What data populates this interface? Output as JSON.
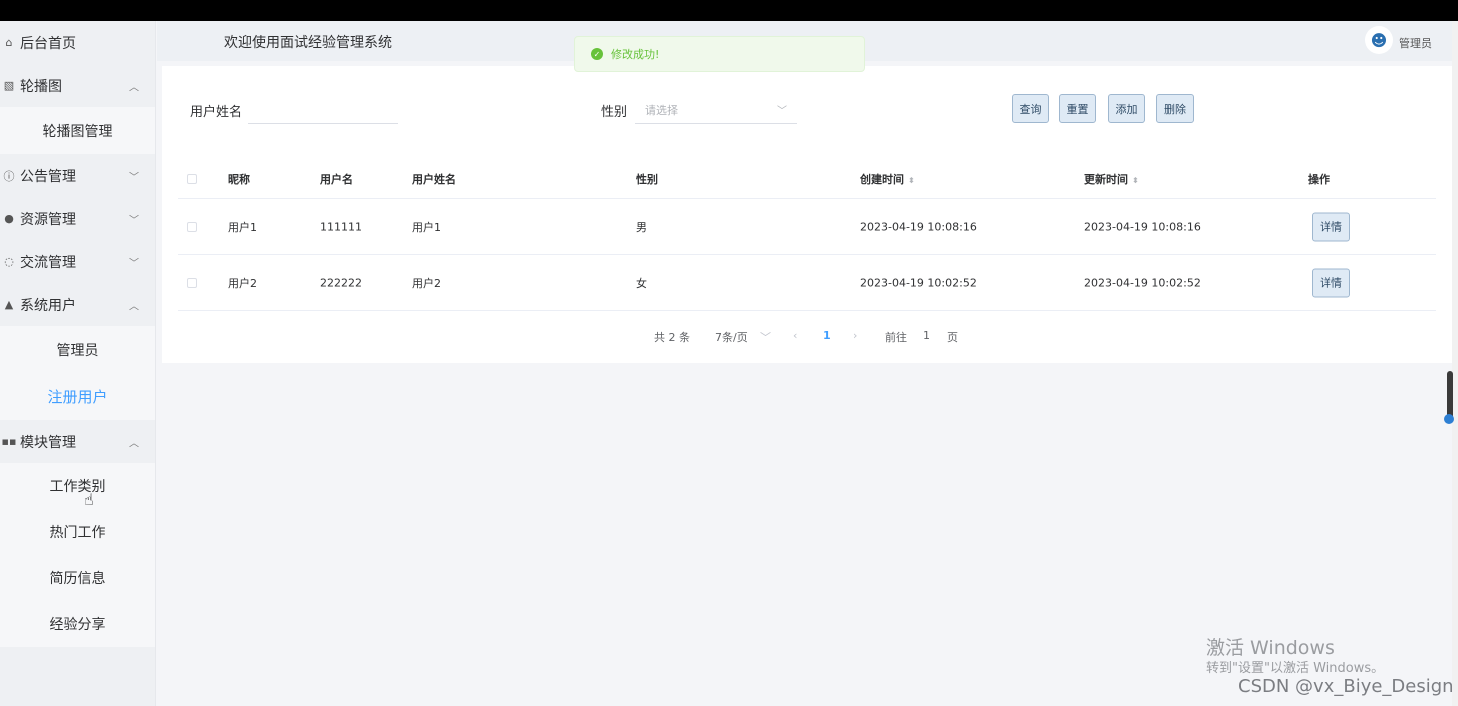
{
  "header": {
    "title": "欢迎使用面试经验管理系统",
    "user": "管理员"
  },
  "toast": {
    "message": "修改成功!"
  },
  "sidebar": {
    "home": "后台首页",
    "carousel": "轮播图",
    "carousel_manage": "轮播图管理",
    "notice": "公告管理",
    "resource": "资源管理",
    "exchange": "交流管理",
    "system_users": "系统用户",
    "admin": "管理员",
    "registered": "注册用户",
    "modules": "模块管理",
    "job_category": "工作类别",
    "hot_jobs": "热门工作",
    "resume": "简历信息",
    "experience": "经验分享"
  },
  "search": {
    "username_label": "用户姓名",
    "username_value": "",
    "gender_label": "性别",
    "gender_placeholder": "请选择",
    "query_btn": "查询",
    "reset_btn": "重置",
    "add_btn": "添加",
    "delete_btn": "删除"
  },
  "table": {
    "headers": {
      "nickname": "昵称",
      "username": "用户名",
      "realname": "用户姓名",
      "gender": "性别",
      "created": "创建时间",
      "updated": "更新时间",
      "actions": "操作"
    },
    "rows": [
      {
        "nickname": "用户1",
        "username": "111111",
        "realname": "用户1",
        "gender": "男",
        "created": "2023-04-19 10:08:16",
        "updated": "2023-04-19 10:08:16",
        "action": "详情"
      },
      {
        "nickname": "用户2",
        "username": "222222",
        "realname": "用户2",
        "gender": "女",
        "created": "2023-04-19 10:02:52",
        "updated": "2023-04-19 10:02:52",
        "action": "详情"
      }
    ]
  },
  "pager": {
    "total": "共 2 条",
    "size": "7条/页",
    "current": "1",
    "goto_prefix": "前往",
    "goto_value": "1",
    "goto_suffix": "页"
  },
  "watermark": {
    "activate_title": "激活 Windows",
    "activate_sub": "转到\"设置\"以激活 Windows。",
    "csdn": "CSDN @vx_Biye_Design"
  },
  "colors": {
    "accent": "#409eff",
    "success": "#67c23a",
    "sidebar_bg": "#eef0f3"
  }
}
